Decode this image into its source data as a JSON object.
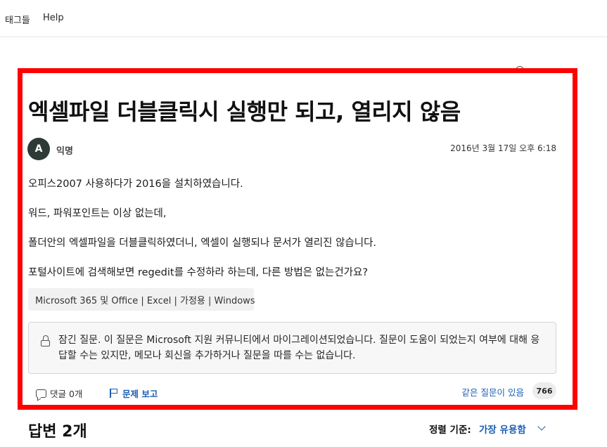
{
  "topnav": {
    "items": [
      {
        "label": "태그들"
      },
      {
        "label": "Help"
      }
    ]
  },
  "question": {
    "title": "엑셀파일 더블클릭시 실행만 되고, 열리지 않음",
    "author": {
      "initial": "A",
      "name": "익명"
    },
    "timestamp": "2016년 3월 17일 오후 6:18",
    "body": [
      "오피스2007 사용하다가 2016을 설치하였습니다.",
      "워드, 파워포인트는 이상 없는데,",
      "폴더안의 엑셀파일을 더블클릭하였더니, 엑셀이 실행되나 문서가 열리진 않습니다.",
      "포털사이트에 검색해보면 regedit를 수정하라 하는데, 다른 방법은 없는건가요?"
    ],
    "tags": "Microsoft 365 및 Office | Excel | 가정용 | Windows",
    "locked_notice": "잠긴 질문. 이 질문은 Microsoft 지원 커뮤니티에서 마이그레이션되었습니다. 질문이 도움이 되었는지 여부에 대해 응답할 수는 있지만, 메모나 회신을 추가하거나 질문을 따를 수는 없습니다.",
    "actions": {
      "reply_label": "댓글 0개",
      "report_label": "문제 보고",
      "same_question_label": "같은 질문이 있음",
      "same_question_count": "766"
    }
  },
  "answers": {
    "heading": "답변 2개",
    "sort_label": "정렬 기준:",
    "sort_value": "가장 유용함"
  },
  "colors": {
    "highlight_border": "#ff0000",
    "link": "#1a5fb4",
    "avatar_bg": "#2d3a35"
  }
}
